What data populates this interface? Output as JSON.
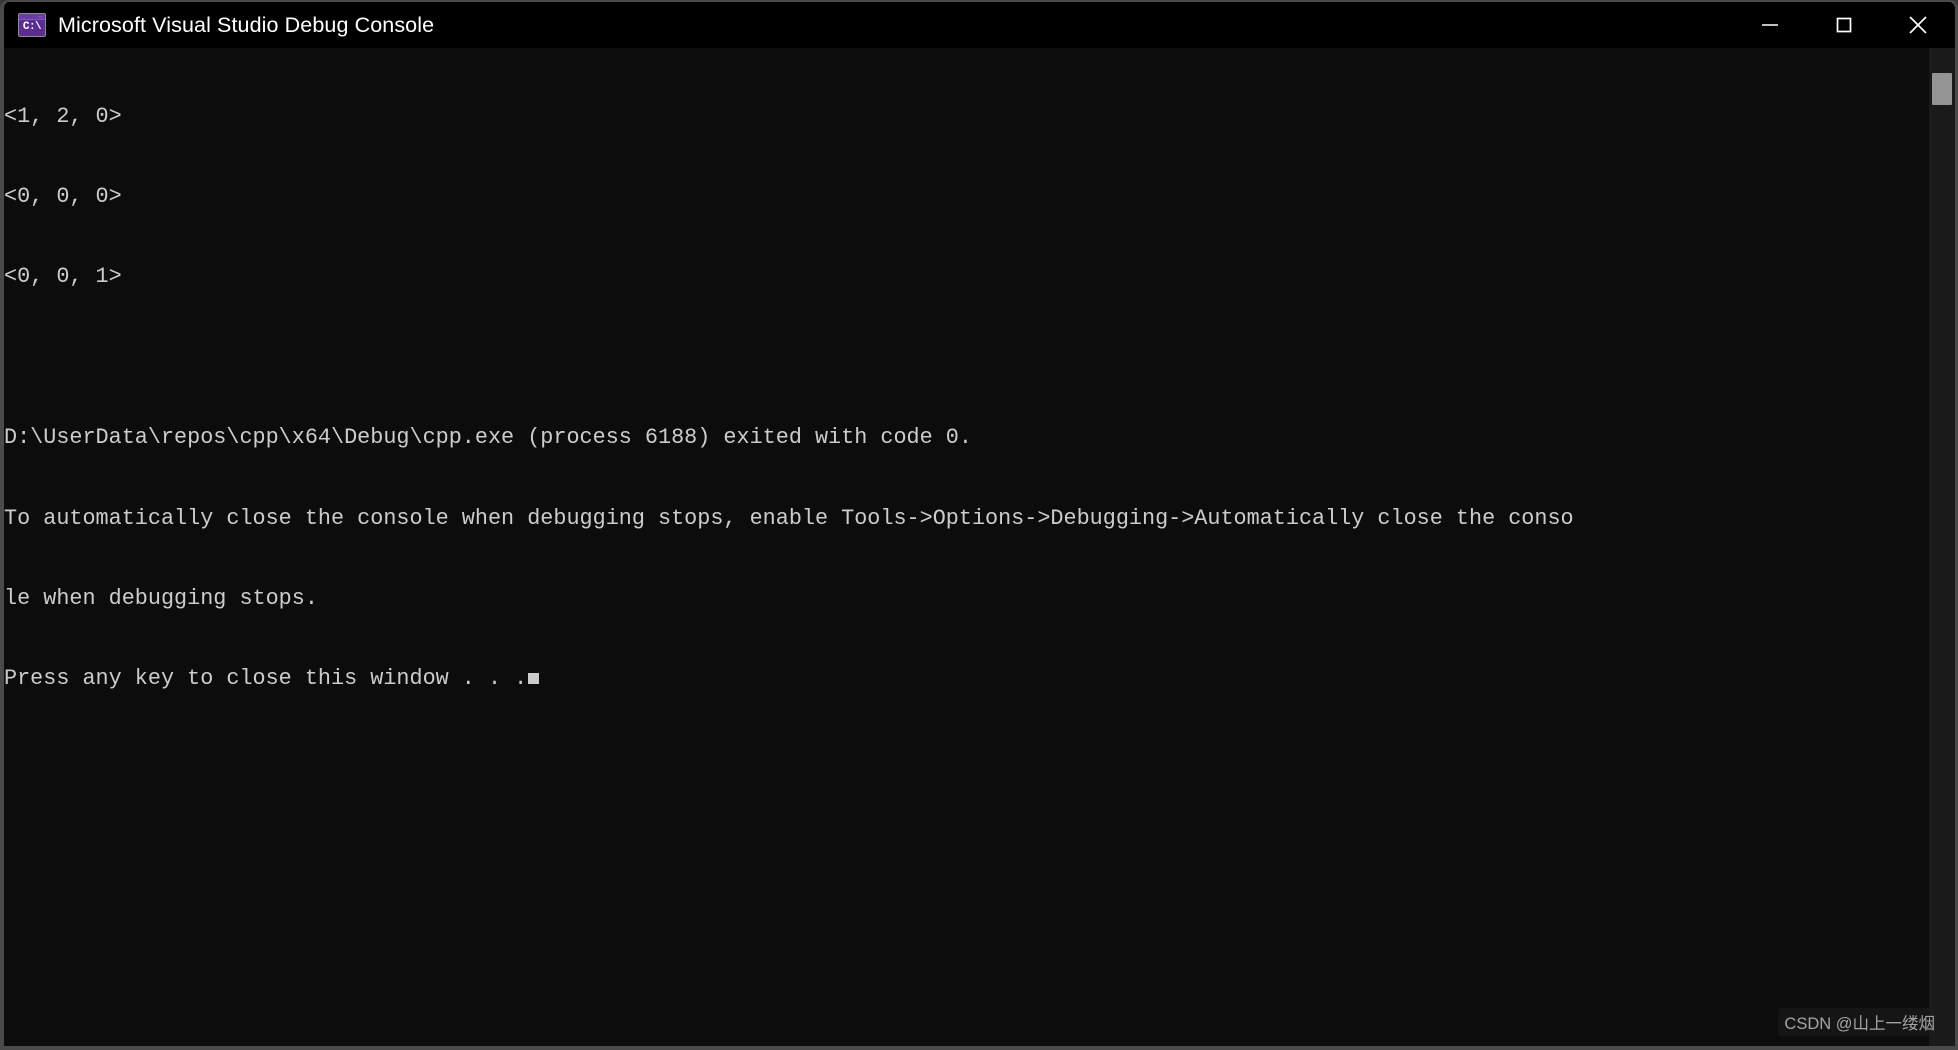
{
  "window": {
    "title": "Microsoft Visual Studio Debug Console",
    "icon_name": "console-app-icon",
    "icon_text": "C:\\",
    "background_color": "#0c0c0c",
    "titlebar_color": "#000000",
    "text_color": "#cccccc",
    "accent_color": "#5c2d91"
  },
  "controls": {
    "minimize_label": "Minimize",
    "maximize_label": "Maximize",
    "close_label": "Close"
  },
  "console": {
    "lines": [
      "<1, 2, 0>",
      "<0, 0, 0>",
      "<0, 0, 1>",
      "",
      "D:\\UserData\\repos\\cpp\\x64\\Debug\\cpp.exe (process 6188) exited with code 0.",
      "To automatically close the console when debugging stops, enable Tools->Options->Debugging->Automatically close the conso",
      "le when debugging stops.",
      "Press any key to close this window . . ."
    ],
    "cursor_visible": true,
    "program_path": "D:\\UserData\\repos\\cpp\\x64\\Debug\\cpp.exe",
    "process_id": "6188",
    "exit_code": "0"
  },
  "scrollbar": {
    "thumb_position_label": "top"
  },
  "watermark": {
    "text": "CSDN @山上一缕烟"
  }
}
